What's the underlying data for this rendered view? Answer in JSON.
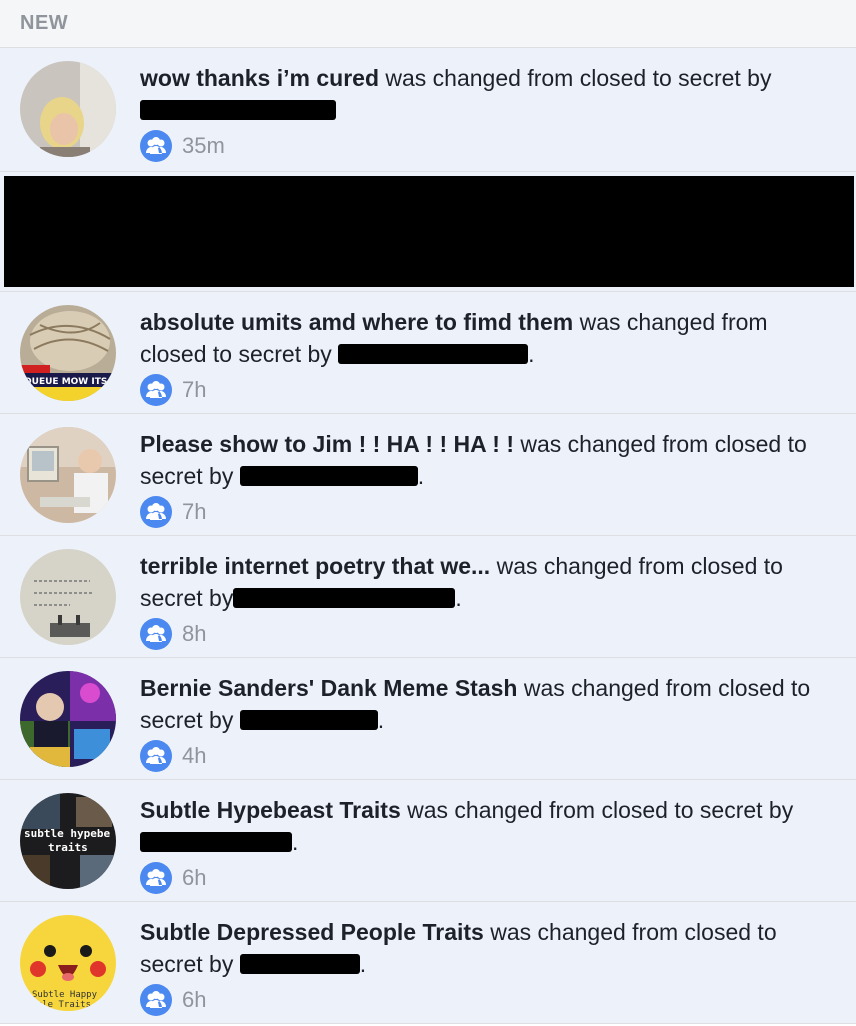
{
  "header": {
    "title": "NEW"
  },
  "notifications": [
    {
      "group": "wow thanks i’m cured",
      "action": " was changed from closed to secret by",
      "time": "35m",
      "avatar": "person-photo"
    },
    {
      "group": "absolute umits amd where to fimd them",
      "action": " was changed from closed to secret by ",
      "time": "7h",
      "avatar": "meme-news-photo"
    },
    {
      "group": "Please show to Jim ! ! HA ! ! HA ! !",
      "action": " was changed from closed to secret by ",
      "time": "7h",
      "avatar": "old-man-computer-photo"
    },
    {
      "group": "terrible internet poetry that we...",
      "action": " was changed from closed to secret by",
      "time": "8h",
      "avatar": "typewriter-photo"
    },
    {
      "group": "Bernie Sanders' Dank Meme Stash",
      "action": " was changed from closed to secret by ",
      "time": "4h",
      "avatar": "collage-photo"
    },
    {
      "group": "Subtle Hypebeast Traits",
      "action": " was changed from closed to secret by",
      "time": "6h",
      "avatar": "hypebeast-photo"
    },
    {
      "group": "Subtle Depressed People Traits",
      "action": " was changed from closed to secret by ",
      "time": "6h",
      "avatar": "pikachu-photo"
    }
  ],
  "colors": {
    "header_bg": "#f5f6f7",
    "unread_bg": "#edf2fa",
    "icon_blue": "#4b88f0",
    "meta_gray": "#90949c"
  },
  "icons": {
    "group": "group-icon"
  }
}
